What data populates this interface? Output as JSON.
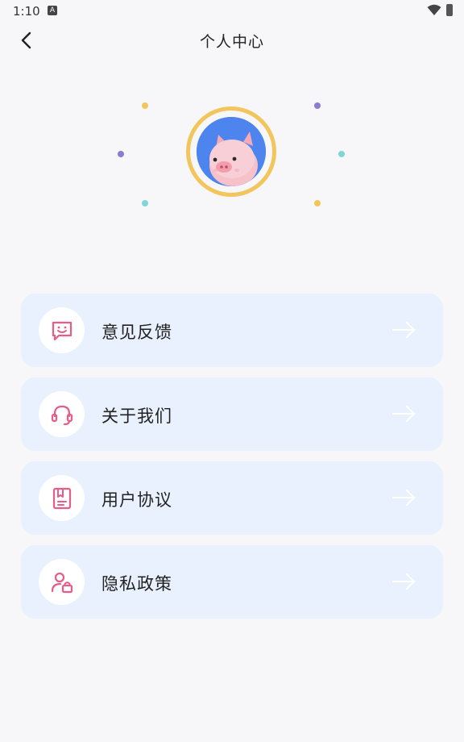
{
  "status_bar": {
    "time": "1:10",
    "notification_badge": "A"
  },
  "header": {
    "title": "个人中心",
    "back_icon": "chevron-left-icon"
  },
  "avatar": {
    "image": "pig-avatar",
    "ring_color": "#f2c65c",
    "background": "#4d84ee"
  },
  "decorations": {
    "dot_colors": [
      "#f2c65c",
      "#8b7bd1",
      "#7fd6d9"
    ]
  },
  "menu": {
    "items": [
      {
        "label": "意见反馈",
        "icon": "feedback-smile-icon"
      },
      {
        "label": "关于我们",
        "icon": "headset-icon"
      },
      {
        "label": "用户协议",
        "icon": "agreement-book-icon"
      },
      {
        "label": "隐私政策",
        "icon": "user-lock-icon"
      }
    ],
    "accent": "#e85c86",
    "item_background": "#e8f1fd"
  }
}
